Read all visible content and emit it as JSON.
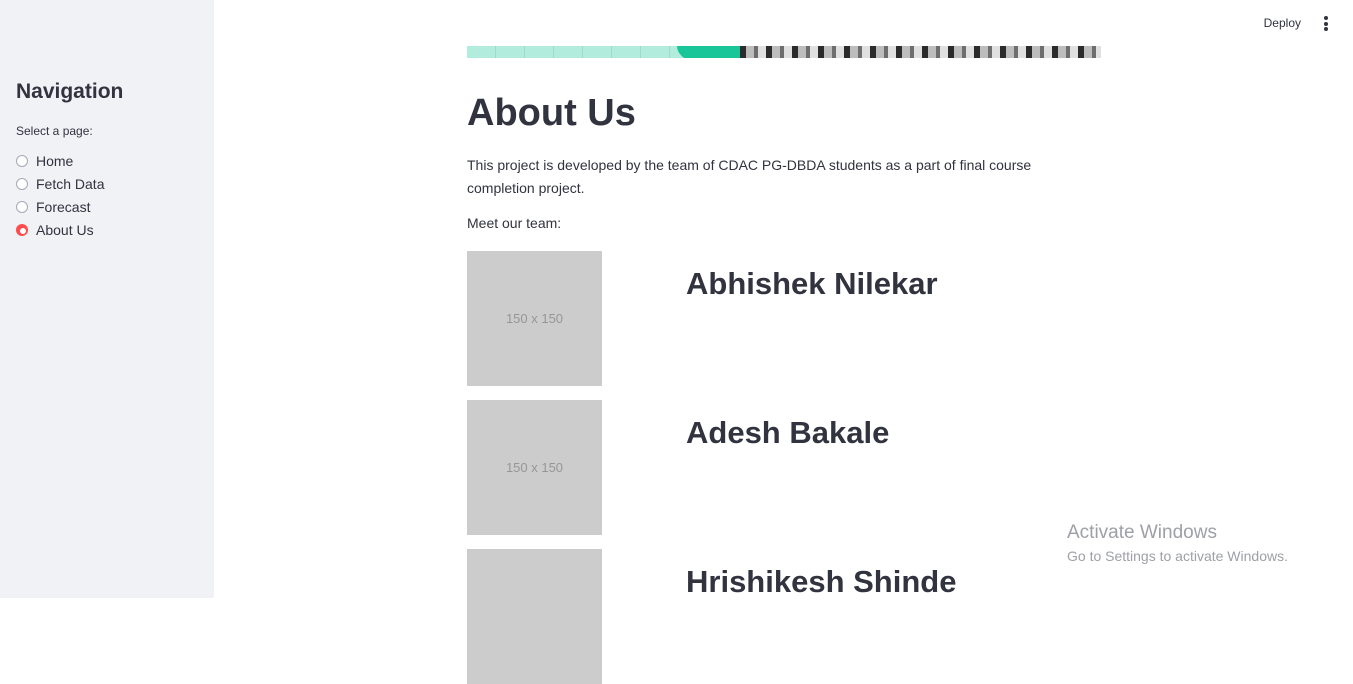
{
  "sidebar": {
    "title": "Navigation",
    "radio_label": "Select a page:",
    "items": [
      {
        "label": "Home",
        "selected": false
      },
      {
        "label": "Fetch Data",
        "selected": false
      },
      {
        "label": "Forecast",
        "selected": false
      },
      {
        "label": "About Us",
        "selected": true
      }
    ],
    "accent_color": "#ff4b4b"
  },
  "topbar": {
    "deploy_label": "Deploy",
    "menu_icon": "more-vertical-icon"
  },
  "main": {
    "title": "About Us",
    "intro": "This project is developed by the team of CDAC PG-DBDA students as a part of final course completion project.",
    "meet_label": "Meet our team:",
    "team": [
      {
        "name": "Abhishek Nilekar",
        "photo_text": "150 x 150"
      },
      {
        "name": "Adesh Bakale",
        "photo_text": "150 x 150"
      },
      {
        "name": "Hrishikesh Shinde",
        "photo_text": ""
      }
    ]
  },
  "watermark": {
    "title": "Activate Windows",
    "subtitle": "Go to Settings to activate Windows."
  }
}
